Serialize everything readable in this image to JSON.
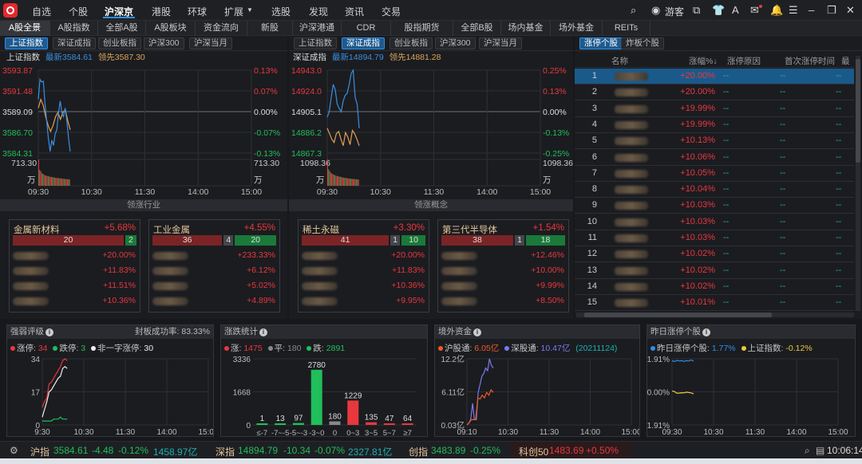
{
  "nav": {
    "items": [
      "自选",
      "个股",
      "沪深京",
      "港股",
      "环球",
      "扩展",
      "选股",
      "发现",
      "资讯",
      "交易"
    ],
    "active": "沪深京",
    "user": "游客"
  },
  "tabs": [
    "A股全景",
    "A股指数",
    "全部A股",
    "A股板块",
    "资金流向",
    "新股",
    "沪深港通",
    "CDR",
    "股指期货",
    "全部B股",
    "场内基金",
    "场外基金",
    "REITs"
  ],
  "subtabs_left": [
    "上证指数",
    "深证成指",
    "创业板指",
    "沪深300",
    "沪深当月"
  ],
  "subtabs_mid": [
    "上证指数",
    "深证成指",
    "创业板指",
    "沪深300",
    "沪深当月"
  ],
  "subtabs_right": [
    "涨停个股",
    "炸板个股"
  ],
  "colors": {
    "up": "#e8383d",
    "down": "#1fbf5a",
    "price_line": "#3a8fe0",
    "avg_line": "#e0a050",
    "accent": "#2f8ee8"
  },
  "index_sh": {
    "name": "上证指数",
    "latest": "最新3584.61",
    "lead": "领先3587.30",
    "price_labels": [
      "3593.87",
      "3591.48",
      "3589.09",
      "3586.70",
      "3584.31"
    ],
    "pct_labels": [
      "0.13%",
      "0.07%",
      "0.00%",
      "-0.07%",
      "-0.13%"
    ],
    "vol_label": "713.30",
    "vol_unit": "万",
    "times": [
      "09:30",
      "10:30",
      "11:30",
      "14:00",
      "15:00"
    ],
    "ymax": 3593.87,
    "ymin": 3584.31,
    "progress": 0.15,
    "price": [
      3590.5,
      3592.8,
      3592.5,
      3592.6,
      3590,
      3588,
      3586,
      3584.5,
      3585.8,
      3585.2,
      3586.5,
      3587,
      3589,
      3590.3,
      3589,
      3588.5,
      3589.5,
      3588,
      3586,
      3584.5
    ],
    "avg": [
      3589.5,
      3590.5,
      3589.8,
      3588.5,
      3587.5,
      3586.8,
      3587.5,
      3588.5,
      3589,
      3588.2,
      3589,
      3589.3,
      3588,
      3587
    ],
    "volume": [
      1.0,
      0.6,
      0.55,
      0.48,
      0.45,
      0.42,
      0.4,
      0.38,
      0.37,
      0.36,
      0.35,
      0.34,
      0.33,
      0.33,
      0.32,
      0.31,
      0.3,
      0.3,
      0.29,
      0.29,
      0.28,
      0.28,
      0.27,
      0.27,
      0.26,
      0.26,
      0.25,
      0.25,
      0.25,
      0.24
    ]
  },
  "index_sz": {
    "name": "深证成指",
    "latest": "最新14894.79",
    "lead": "领先14881.28",
    "price_labels": [
      "14943.0",
      "14924.0",
      "14905.1",
      "14886.2",
      "14867.3"
    ],
    "pct_labels": [
      "0.25%",
      "0.13%",
      "0.00%",
      "-0.13%",
      "-0.25%"
    ],
    "vol_label": "1098.36",
    "vol_unit": "万",
    "times": [
      "09:30",
      "10:30",
      "11:30",
      "14:00",
      "15:00"
    ],
    "ymax": 14943.0,
    "ymin": 14867.3,
    "progress": 0.15,
    "price": [
      14900,
      14905,
      14918,
      14930,
      14925,
      14912,
      14908,
      14905,
      14915,
      14920,
      14922,
      14930,
      14940,
      14943,
      14918,
      14912,
      14890
    ],
    "avg": [
      14890,
      14885,
      14880,
      14877,
      14885,
      14887,
      14880,
      14874,
      14886,
      14882,
      14875,
      14888,
      14885,
      14880,
      14874
    ],
    "volume": [
      1.0,
      0.62,
      0.55,
      0.5,
      0.46,
      0.44,
      0.42,
      0.4,
      0.38,
      0.37,
      0.36,
      0.35,
      0.34,
      0.33,
      0.32,
      0.31,
      0.3,
      0.3,
      0.29,
      0.28,
      0.28,
      0.27,
      0.27,
      0.26,
      0.26,
      0.25,
      0.25,
      0.25,
      0.24,
      0.24
    ]
  },
  "industry": {
    "title": "领涨行业",
    "cards": [
      {
        "name": "金属新材料",
        "pct": "+5.68%",
        "up": 20,
        "flat": 0,
        "down": 2,
        "rows": [
          "+20.00%",
          "+11.83%",
          "+11.51%",
          "+10.36%"
        ]
      },
      {
        "name": "工业金属",
        "pct": "+4.55%",
        "up": 36,
        "flat": 4,
        "down": 20,
        "rows": [
          "+233.33%",
          "+6.12%",
          "+5.02%",
          "+4.89%"
        ]
      }
    ]
  },
  "concept": {
    "title": "领涨概念",
    "cards": [
      {
        "name": "稀土永磁",
        "pct": "+3.30%",
        "up": 41,
        "flat": 1,
        "down": 10,
        "rows": [
          "+20.00%",
          "+11.83%",
          "+10.36%",
          "+9.95%"
        ]
      },
      {
        "name": "第三代半导体",
        "pct": "+1.54%",
        "up": 38,
        "flat": 1,
        "down": 18,
        "rows": [
          "+12.46%",
          "+10.00%",
          "+9.99%",
          "+8.50%"
        ]
      }
    ]
  },
  "limit_list": {
    "headers": [
      "名称",
      "涨幅%↓",
      "涨停原因",
      "首次涨停时间",
      "最终"
    ],
    "rows": [
      {
        "n": "1",
        "p": "+20.00%"
      },
      {
        "n": "2",
        "p": "+20.00%"
      },
      {
        "n": "3",
        "p": "+19.99%"
      },
      {
        "n": "4",
        "p": "+19.99%"
      },
      {
        "n": "5",
        "p": "+10.13%"
      },
      {
        "n": "6",
        "p": "+10.06%"
      },
      {
        "n": "7",
        "p": "+10.05%"
      },
      {
        "n": "8",
        "p": "+10.04%"
      },
      {
        "n": "9",
        "p": "+10.03%"
      },
      {
        "n": "10",
        "p": "+10.03%"
      },
      {
        "n": "11",
        "p": "+10.03%"
      },
      {
        "n": "12",
        "p": "+10.02%"
      },
      {
        "n": "13",
        "p": "+10.02%"
      },
      {
        "n": "14",
        "p": "+10.02%"
      },
      {
        "n": "15",
        "p": "+10.01%"
      }
    ],
    "empty": "--"
  },
  "strength": {
    "title": "强弱评级",
    "rate_label": "封板成功率: 83.33%",
    "leg": [
      {
        "k": "涨停: ",
        "v": "34"
      },
      {
        "k": "跌停: ",
        "v": "3"
      },
      {
        "k": "非一字涨停: ",
        "v": "30"
      }
    ],
    "yticks": [
      "34",
      "17",
      "0"
    ],
    "times": [
      "9:30",
      "10:30",
      "11:30",
      "14:00",
      "15:00"
    ],
    "ymax": 34,
    "progress": 0.15,
    "limit_up": [
      9,
      12,
      14,
      21,
      22,
      24,
      26,
      28,
      30,
      33,
      34,
      33
    ],
    "limit_down": [
      2,
      2,
      2,
      2,
      2,
      3,
      3,
      3,
      4,
      3,
      3,
      3
    ],
    "non_one": [
      4,
      8,
      12,
      17,
      18,
      20,
      22,
      24,
      25,
      29,
      30,
      29
    ]
  },
  "updown": {
    "title": "涨跌统计",
    "leg": [
      {
        "k": "涨: ",
        "v": "1475"
      },
      {
        "k": "平: ",
        "v": "180"
      },
      {
        "k": "跌: ",
        "v": "2891"
      }
    ],
    "yticks": [
      "3336",
      "1668",
      "0"
    ],
    "ymax": 3336,
    "chart_data": {
      "type": "bar",
      "categories": [
        "≤-7",
        "-7~-5",
        "-5~-3",
        "-3~0",
        "0",
        "0~3",
        "3~5",
        "5~7",
        "≥7"
      ],
      "values": [
        1,
        13,
        97,
        2780,
        180,
        1229,
        135,
        47,
        64
      ]
    }
  },
  "northbound": {
    "title": "境外资金",
    "leg": [
      {
        "k": "沪股通: ",
        "v": "6.05亿"
      },
      {
        "k": "深股通: ",
        "v": "10.47亿"
      }
    ],
    "date": "(20211124)",
    "yticks": [
      "12.2亿",
      "6.11亿",
      "0.03亿"
    ],
    "times": [
      "09:10",
      "10:30",
      "11:30",
      "14:00",
      "15:00"
    ],
    "ymax": 12.2,
    "ymin": 0.03,
    "progress": 0.16,
    "sz": [
      0.03,
      0.4,
      1,
      4,
      1,
      1,
      6,
      7.5,
      9,
      9.5,
      10.5,
      10,
      12.2,
      11,
      10.5
    ],
    "sh": [
      0.03,
      0.4,
      1,
      1,
      1,
      5,
      4.8,
      5.5,
      5,
      6,
      5.5,
      6.5,
      6
    ]
  },
  "yesterday": {
    "title": "昨日涨停个股",
    "leg": [
      {
        "k": "昨日涨停个股: ",
        "v": "1.77%"
      },
      {
        "k": "上证指数: ",
        "v": "-0.12%"
      }
    ],
    "yticks": [
      "1.91%",
      "0.00%",
      "-1.91%"
    ],
    "times": [
      "09:30",
      "10:30",
      "11:30",
      "14:00",
      "15:00"
    ],
    "ymax": 1.91,
    "ymin": -1.91,
    "progress": 0.13,
    "stocks": [
      1.8,
      1.75,
      1.82,
      1.78,
      1.8,
      1.76,
      1.8,
      1.78,
      1.84,
      1.77
    ],
    "index": [
      0.05,
      0.02,
      -0.08,
      -0.07,
      -0.05,
      -0.06,
      -0.02,
      -0.04,
      -0.06,
      -0.12
    ]
  },
  "status": {
    "sh": {
      "name": "沪指",
      "price": "3584.61",
      "chg": "-4.48",
      "pct": "-0.12%",
      "amt": "1458.97亿"
    },
    "sz": {
      "name": "深指",
      "price": "14894.79",
      "chg": "-10.34",
      "pct": "-0.07%",
      "amt": "2327.81亿"
    },
    "cy": {
      "name": "创指",
      "price": "3483.89",
      "pct": "-0.25%"
    },
    "kc": {
      "name": "科创50",
      "price": "1483.69",
      "pct": "+0.50%"
    },
    "time": "10:06:14"
  }
}
